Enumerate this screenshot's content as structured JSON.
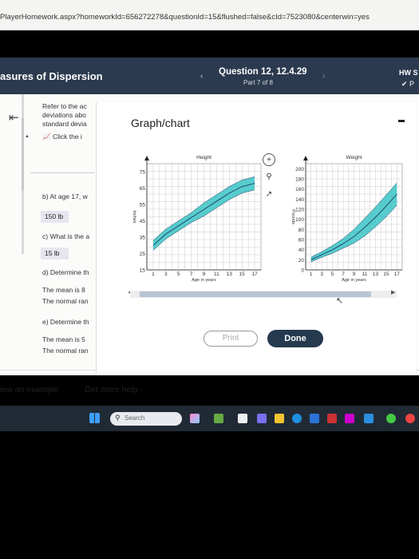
{
  "browser": {
    "url": "PlayerHomework.aspx?homeworkId=656272278&questionId=15&flushed=false&cId=7523080&centerwin=yes"
  },
  "header": {
    "section_title": "asures of Dispersion",
    "question_title": "Question 12, 12.4.29",
    "question_part": "Part 7 of 8",
    "hw_label": "HW S",
    "hw_sub": "P"
  },
  "question": {
    "intro_lines": [
      "Refer to the ac",
      "deviations abo",
      "standard devia"
    ],
    "click_text": "Click the i",
    "part_b": "b) At age 17, w",
    "part_b_answer": "150 lb",
    "part_c": "c) What is the a",
    "part_c_answer": "15 lb",
    "part_d": "d) Determine th",
    "part_d_line1": "The mean is 8",
    "part_d_line2": "The normal ran",
    "part_e": "e) Determine th",
    "part_e_line1": "The mean is 5",
    "part_e_line2": "The normal ran"
  },
  "panel": {
    "title": "Graph/chart",
    "print_label": "Print",
    "done_label": "Done"
  },
  "chart_data": [
    {
      "type": "area",
      "title": "Height",
      "xlabel": "Age in years",
      "ylabel": "Inches",
      "x_ticks": [
        "1",
        "3",
        "5",
        "7",
        "9",
        "11",
        "13",
        "15",
        "17"
      ],
      "y_ticks": [
        "15",
        "25",
        "35",
        "45",
        "55",
        "65",
        "75"
      ],
      "xlim": [
        0,
        18
      ],
      "ylim": [
        15,
        80
      ],
      "x": [
        1,
        3,
        5,
        7,
        9,
        11,
        13,
        15,
        17
      ],
      "mean": [
        30,
        37,
        42,
        47,
        52,
        57,
        62,
        66,
        68
      ],
      "upper": [
        33,
        40,
        45,
        50,
        56,
        61,
        66,
        70,
        72
      ],
      "lower": [
        27,
        34,
        39,
        44,
        48,
        53,
        58,
        62,
        64
      ],
      "band_color": "#3bc4c4",
      "line_color": "#1a3a6a",
      "grid": true
    },
    {
      "type": "area",
      "title": "Weight",
      "xlabel": "Age in years",
      "ylabel": "Pounds",
      "x_ticks": [
        "1",
        "3",
        "5",
        "7",
        "9",
        "11",
        "13",
        "15",
        "17"
      ],
      "y_ticks": [
        "0",
        "20",
        "40",
        "60",
        "80",
        "100",
        "120",
        "140",
        "160",
        "180",
        "200"
      ],
      "xlim": [
        0,
        18
      ],
      "ylim": [
        0,
        210
      ],
      "x": [
        1,
        3,
        5,
        7,
        9,
        11,
        13,
        15,
        17
      ],
      "mean": [
        20,
        30,
        40,
        52,
        66,
        84,
        104,
        126,
        150
      ],
      "upper": [
        25,
        36,
        48,
        62,
        80,
        102,
        124,
        148,
        172
      ],
      "lower": [
        16,
        25,
        33,
        43,
        53,
        67,
        85,
        105,
        128
      ],
      "band_color": "#3bc4c4",
      "line_color": "#1a3a6a",
      "grid": true
    }
  ],
  "footer": {
    "view_example": "iew an example",
    "get_help": "Get more help -"
  },
  "taskbar": {
    "search_placeholder": "Search"
  },
  "colors": {
    "header_bg": "#2b3a4e",
    "done_bg": "#253a4f",
    "band": "#3bc4c4"
  }
}
